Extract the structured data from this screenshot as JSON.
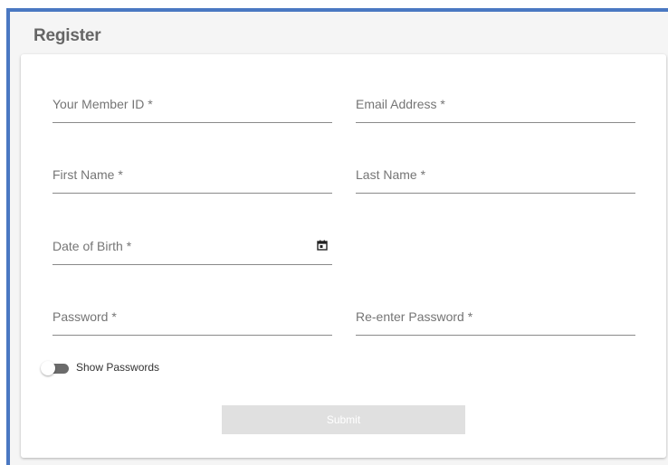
{
  "page": {
    "title": "Register"
  },
  "form": {
    "member_id": {
      "label": "Your Member ID *",
      "value": ""
    },
    "email": {
      "label": "Email Address *",
      "value": ""
    },
    "first_name": {
      "label": "First Name *",
      "value": ""
    },
    "last_name": {
      "label": "Last Name *",
      "value": ""
    },
    "dob": {
      "label": "Date of Birth *",
      "value": "",
      "icon": "calendar-icon"
    },
    "password": {
      "label": "Password *",
      "value": ""
    },
    "password_confirm": {
      "label": "Re-enter Password *",
      "value": ""
    },
    "show_passwords": {
      "label": "Show Passwords",
      "checked": false
    },
    "submit_label": "Submit",
    "submit_disabled": true
  },
  "colors": {
    "frame_accent": "#4a78c2",
    "panel_background": "#f5f5f5",
    "disabled_button": "#e0e0e0"
  }
}
